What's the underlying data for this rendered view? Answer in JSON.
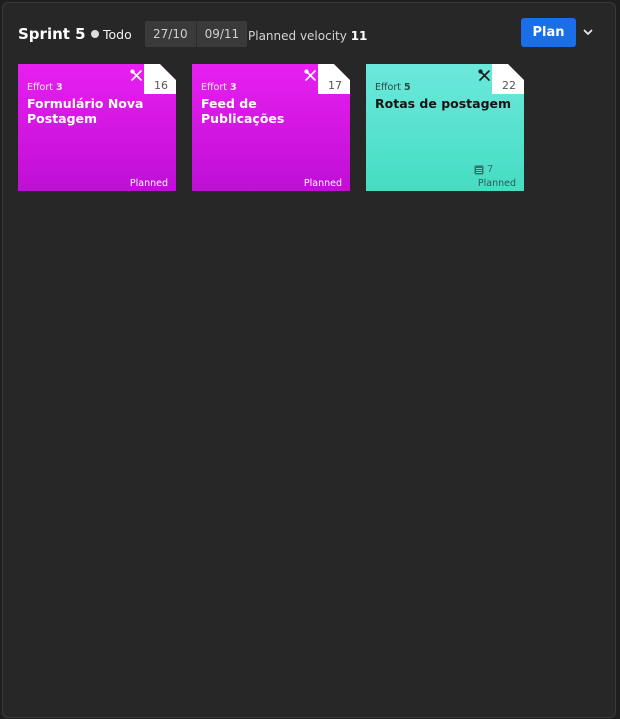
{
  "header": {
    "sprint_title": "Sprint 5",
    "status": "Todo",
    "start_date": "27/10",
    "end_date": "09/11",
    "velocity_label": "Planned velocity",
    "velocity_value": "11",
    "plan_button": "Plan",
    "menu_icon": "chevron-down-icon"
  },
  "colors": {
    "accent": "#1a6fe8",
    "magenta": "#e81ff0",
    "teal": "#6ce8db"
  },
  "cards": [
    {
      "effort_label": "Effort",
      "effort_value": "3",
      "title": "Formulário Nova Postagem",
      "number": "16",
      "status": "Planned",
      "icon": "tools-icon"
    },
    {
      "effort_label": "Effort",
      "effort_value": "3",
      "title": "Feed de Publicações",
      "number": "17",
      "status": "Planned",
      "icon": "tools-icon"
    },
    {
      "effort_label": "Effort",
      "effort_value": "5",
      "title": "Rotas de postagem",
      "number": "22",
      "subtasks": "7",
      "status": "Planned",
      "icon": "tools-icon"
    }
  ]
}
